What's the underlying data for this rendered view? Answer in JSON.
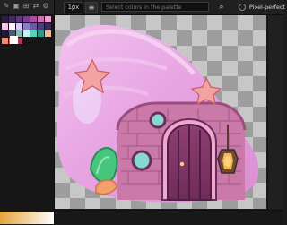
{
  "topbar": {
    "zoom_value": "1px",
    "menu_label": "≡",
    "search_placeholder": "Select colors in the palette",
    "pixel_perfect_label": "Pixel-perfect"
  },
  "left_panel": {
    "tool_icons": [
      "pencil-icon",
      "duplicate-icon",
      "grid-icon",
      "swap-icon",
      "settings-icon"
    ],
    "palette": [
      "#2a1f3d",
      "#3f2c59",
      "#5c3a79",
      "#7a3f91",
      "#a94e9c",
      "#c96fb3",
      "#ee9ccd",
      "#f5c2e4",
      "#fff4ff",
      "#d7c8ff",
      "#8e7cc6",
      "#6b5aa2",
      "#4b3f77",
      "#34295a",
      "#201636",
      "#4d5c6b",
      "#8eb8b3",
      "#c3f1ec",
      "#5ad2b9",
      "#2f9a89",
      "#f2bca0",
      "#ea8f76",
      "#cb5f61",
      "#a53d55"
    ]
  },
  "artwork": {
    "shell_color": "#e8a5e3",
    "wall_color": "#c97aa8",
    "door_color": "#6f2c5a",
    "star_color": "#f3a3a1",
    "window_color": "#87d8d5",
    "leaf_color": "#47c57d"
  }
}
